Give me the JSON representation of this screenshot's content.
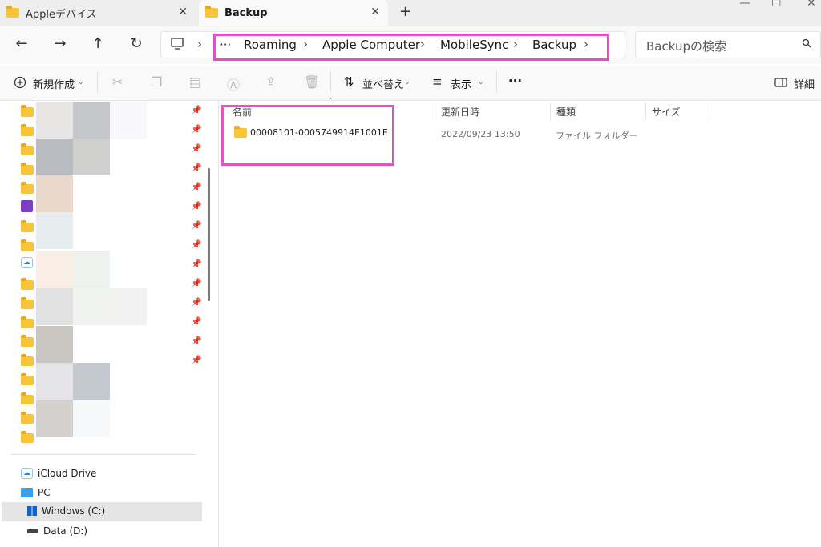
{
  "tabs": [
    {
      "label": "Appleデバイス",
      "active": false
    },
    {
      "label": "Backup",
      "active": true
    }
  ],
  "new_tab_label": "+",
  "window_controls": {
    "minimize": "—",
    "maximize": "☐",
    "close": "✕"
  },
  "nav": {
    "back": "←",
    "forward": "→",
    "up": "↑",
    "refresh": "↻"
  },
  "address": {
    "overflow": "···",
    "separator": "›",
    "crumbs": [
      "Roaming",
      "Apple Computer",
      "MobileSync",
      "Backup"
    ]
  },
  "search": {
    "placeholder": "Backupの検索"
  },
  "commands": {
    "new": "新規作成",
    "sort": "並べ替え",
    "view": "表示",
    "more": "···",
    "details": "詳細"
  },
  "columns": [
    "名前",
    "更新日時",
    "種類",
    "サイズ"
  ],
  "files": [
    {
      "name": "00008101-0005749914E1001E",
      "modified": "2022/09/23 13:50",
      "type": "ファイル フォルダー",
      "size": ""
    }
  ],
  "sidebar": {
    "bottom_items": [
      {
        "label": "iCloud Drive"
      },
      {
        "label": "PC"
      },
      {
        "label": "Windows (C:)",
        "selected": true
      },
      {
        "label": "Data (D:)"
      }
    ]
  },
  "colors": {
    "highlight": "#e84ec6",
    "folder": "#f8c43a",
    "selection": "#e5e5e5"
  }
}
